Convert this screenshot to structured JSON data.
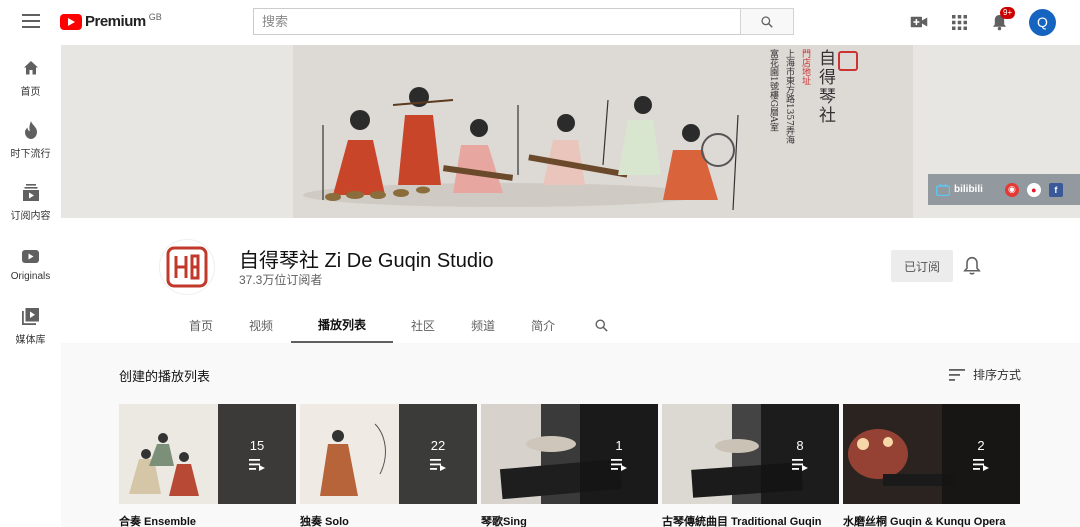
{
  "header": {
    "logo_text": "Premium",
    "logo_region": "GB",
    "search_placeholder": "搜索",
    "notification_badge": "9+",
    "avatar_letter": "Q"
  },
  "sidebar": {
    "items": [
      {
        "label": "首页",
        "icon": "home-icon"
      },
      {
        "label": "时下流行",
        "icon": "trending-icon"
      },
      {
        "label": "订阅内容",
        "icon": "subscriptions-icon"
      },
      {
        "label": "Originals",
        "icon": "originals-icon"
      },
      {
        "label": "媒体库",
        "icon": "library-icon"
      }
    ]
  },
  "banner": {
    "studio_name": "自得琴社",
    "address_label": "門店地址",
    "address_line1": "上海市東方路1357弄海",
    "address_line2": "富花園1號樓G層A室",
    "social_bilibili": "bilibili"
  },
  "channel": {
    "name": "自得琴社 Zi De Guqin Studio",
    "subscribers": "37.3万位订阅者",
    "subscribe_label": "已订阅",
    "tabs": [
      "首页",
      "视频",
      "播放列表",
      "社区",
      "频道",
      "简介"
    ],
    "active_tab": "播放列表"
  },
  "content": {
    "section_title": "创建的播放列表",
    "sort_label": "排序方式",
    "playlists": [
      {
        "title": "合奏 Ensemble",
        "count": "15"
      },
      {
        "title": "独奏 Solo",
        "count": "22"
      },
      {
        "title": "琴歌Sing",
        "count": "1"
      },
      {
        "title": "古琴傳統曲目 Traditional Guqin",
        "count": "8"
      },
      {
        "title": "水磨丝桐 Guqin & Kunqu Opera",
        "count": "2"
      }
    ]
  },
  "colors": {
    "brand_red": "#ff0000",
    "avatar_blue": "#1565c0",
    "badge_red": "#cc0000"
  }
}
